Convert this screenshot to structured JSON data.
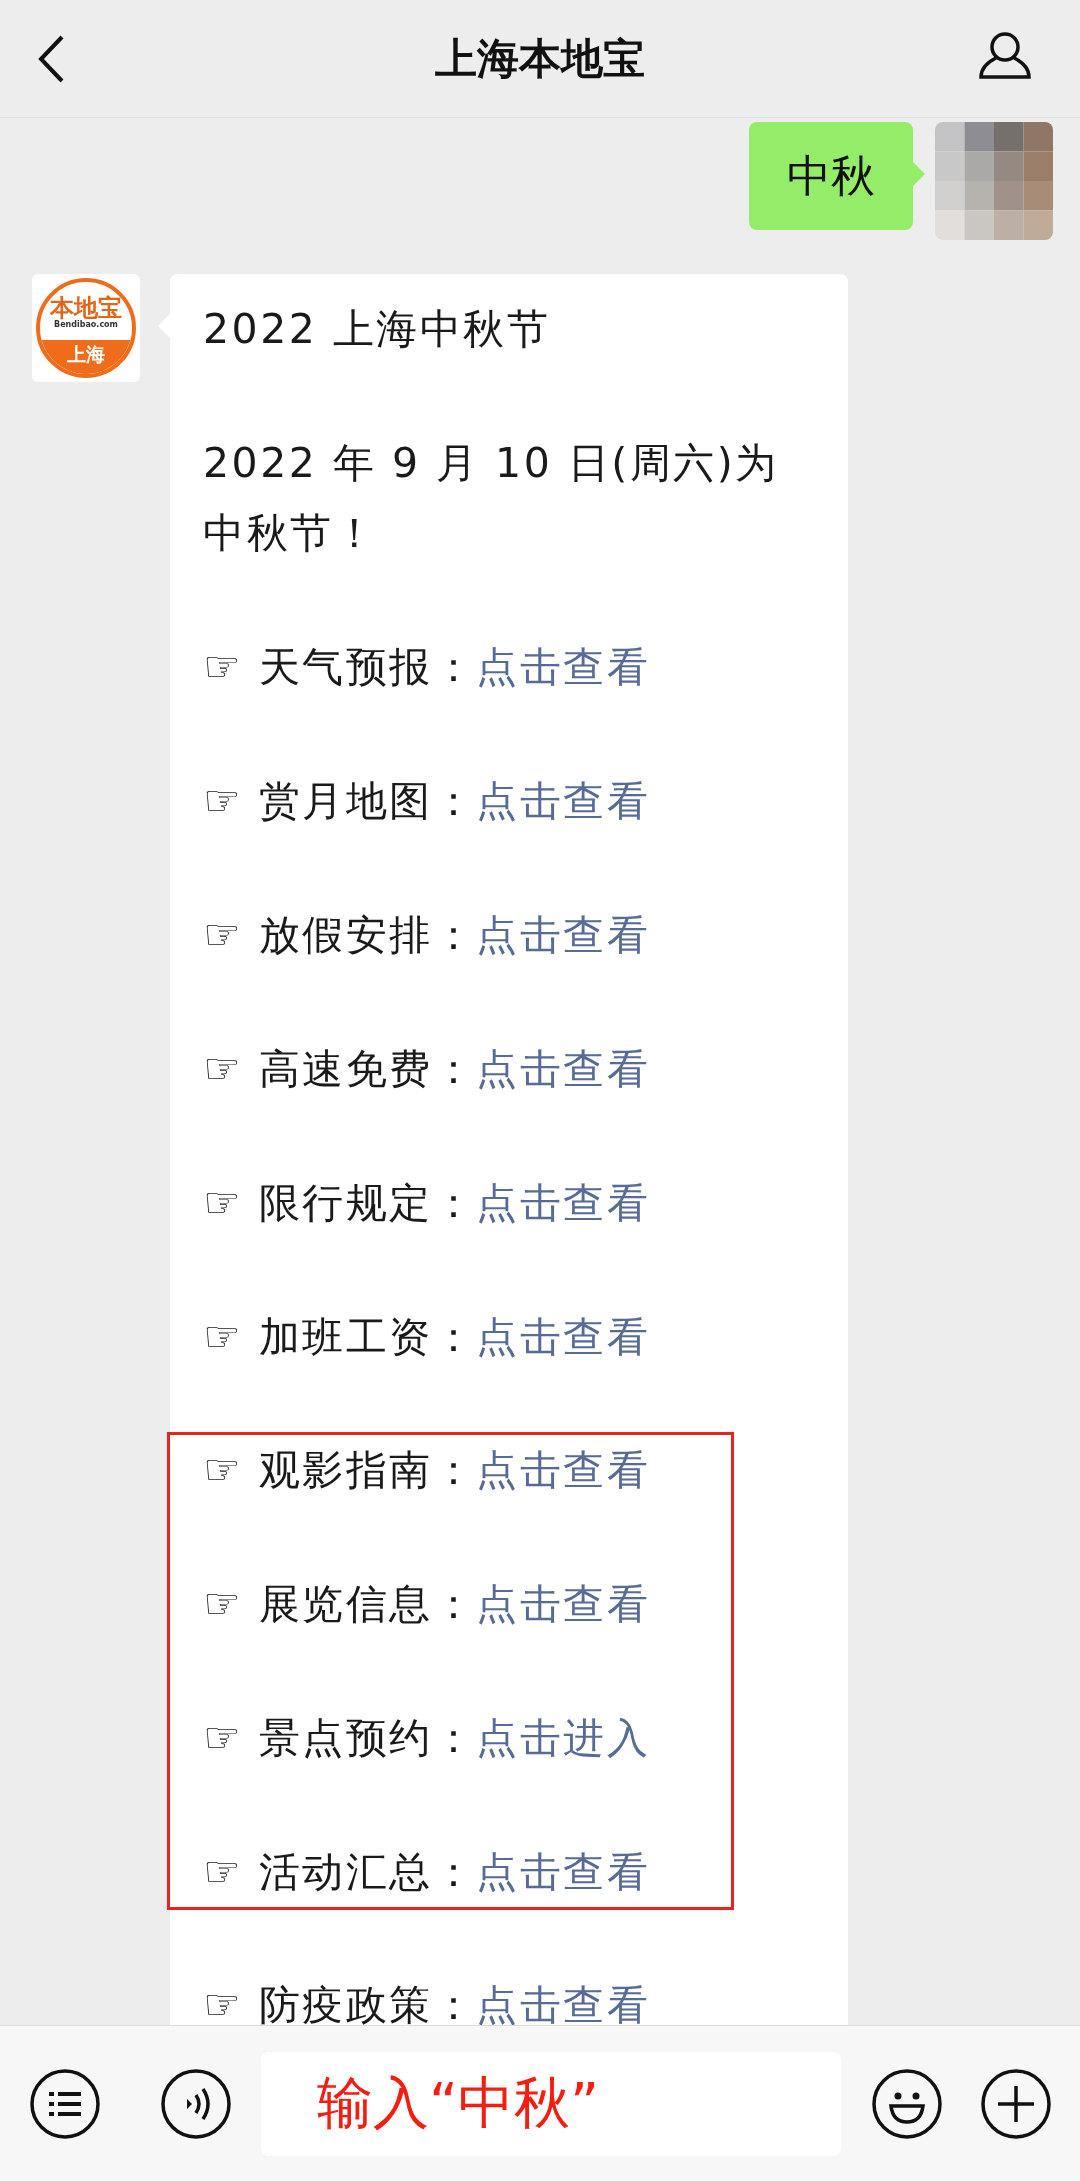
{
  "header": {
    "title": "上海本地宝"
  },
  "messages": [
    {
      "kind": "sent",
      "text": "中秋"
    },
    {
      "kind": "received",
      "avatar": {
        "brand": "本地宝",
        "domain": "Bendibao.com",
        "city": "上海"
      },
      "title": "2022 上海中秋节",
      "intro": "2022 年 9 月 10 日(周六)为中秋节！",
      "items": [
        {
          "bullet": "☞",
          "label": "天气预报：",
          "link": "点击查看",
          "highlighted": false
        },
        {
          "bullet": "☞",
          "label": "赏月地图：",
          "link": "点击查看",
          "highlighted": false
        },
        {
          "bullet": "☞",
          "label": "放假安排：",
          "link": "点击查看",
          "highlighted": false
        },
        {
          "bullet": "☞",
          "label": "高速免费：",
          "link": "点击查看",
          "highlighted": false
        },
        {
          "bullet": "☞",
          "label": "限行规定：",
          "link": "点击查看",
          "highlighted": false
        },
        {
          "bullet": "☞",
          "label": "加班工资：",
          "link": "点击查看",
          "highlighted": false
        },
        {
          "bullet": "☞",
          "label": "观影指南：",
          "link": "点击查看",
          "highlighted": true
        },
        {
          "bullet": "☞",
          "label": "展览信息：",
          "link": "点击查看",
          "highlighted": true
        },
        {
          "bullet": "☞",
          "label": "景点预约：",
          "link": "点击进入",
          "highlighted": true
        },
        {
          "bullet": "☞",
          "label": "活动汇总：",
          "link": "点击查看",
          "highlighted": true
        },
        {
          "bullet": "☞",
          "label": "防疫政策：",
          "link": "点击查看",
          "highlighted": false
        }
      ]
    }
  ],
  "input": {
    "value": "输入“中秋”"
  }
}
